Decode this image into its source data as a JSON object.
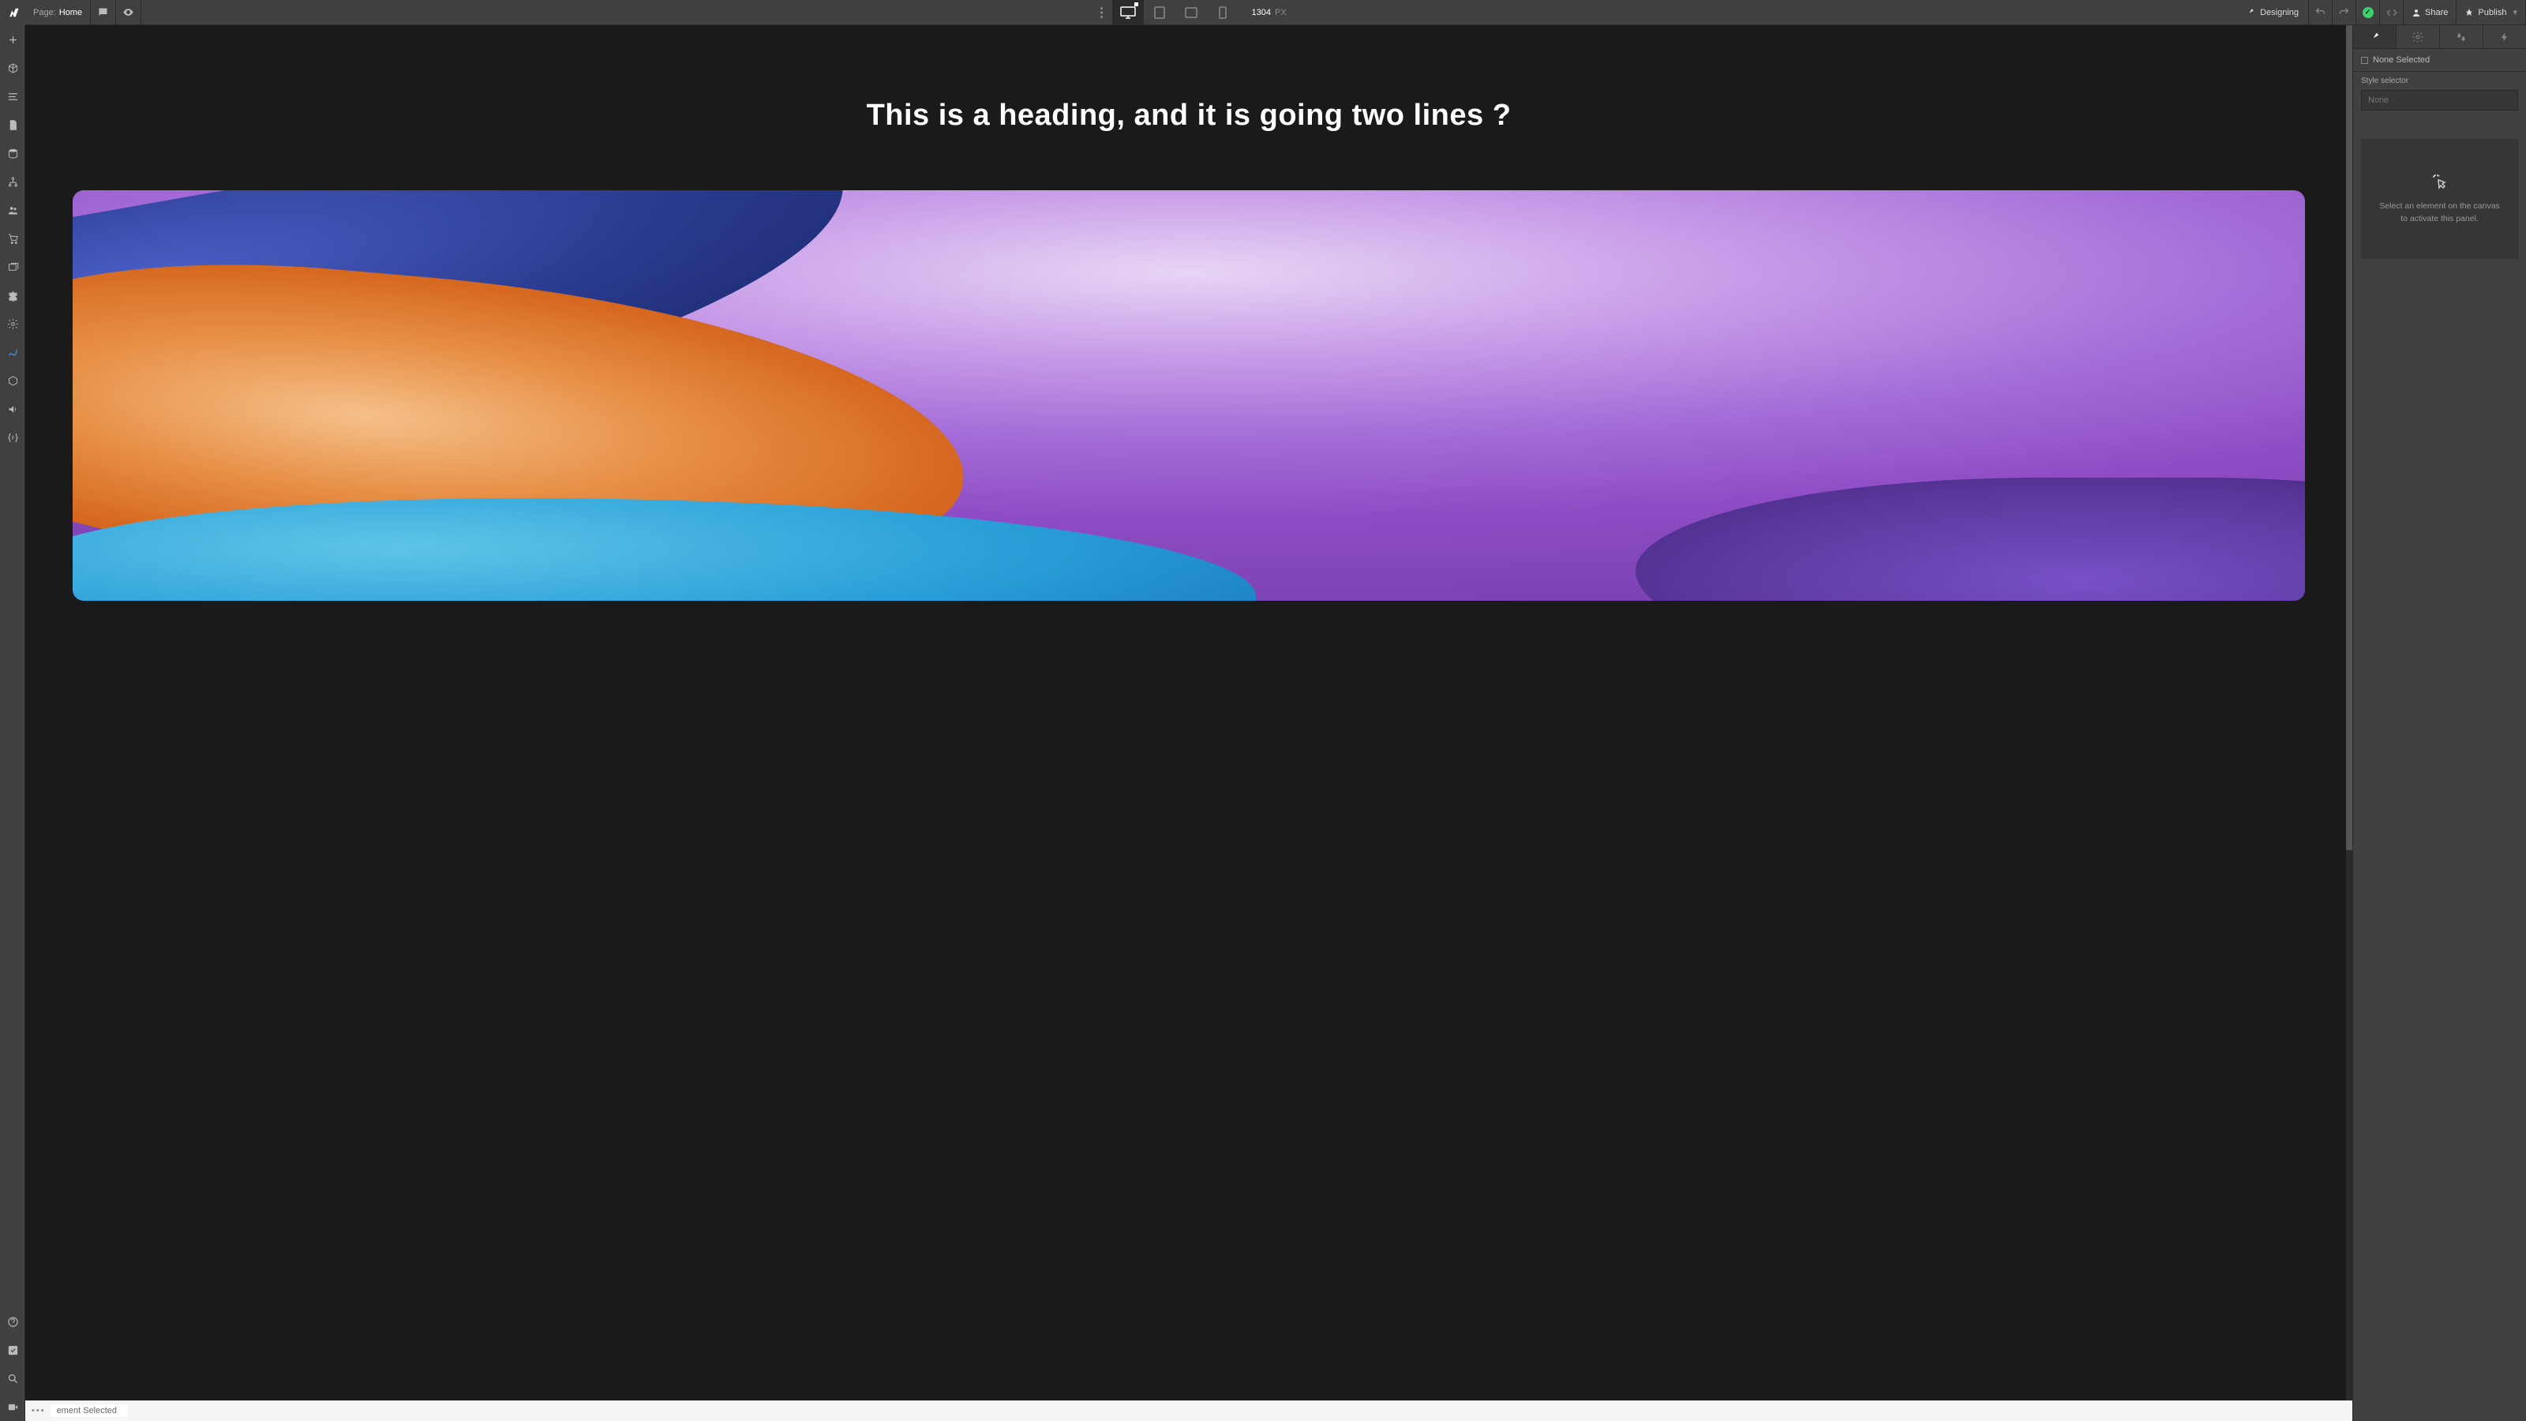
{
  "topbar": {
    "page_label": "Page:",
    "page_name": "Home",
    "viewport_width": "1304",
    "viewport_unit": "PX",
    "designing_label": "Designing",
    "share_label": "Share",
    "publish_label": "Publish"
  },
  "canvas": {
    "heading_text": "This is a heading, and it is going two lines ?"
  },
  "bottom_bar": {
    "selection_text": "ement Selected"
  },
  "right_panel": {
    "selection_text": "None Selected",
    "style_selector_label": "Style selector",
    "selector_placeholder": "None",
    "empty_state_text": "Select an element on the canvas to activate this panel."
  }
}
